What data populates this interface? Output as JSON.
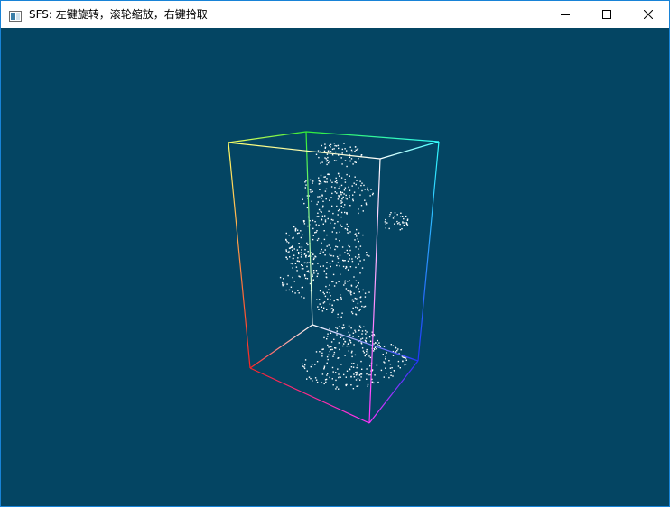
{
  "window": {
    "title": "SFS: 左键旋转，滚轮缩放，右键拾取"
  },
  "icons": {
    "app": "app-window-icon",
    "minimize": "minimize-icon",
    "maximize": "maximize-icon",
    "close": "close-icon"
  },
  "colors": {
    "viewport_background": "#044563",
    "point_color": "#ffffff",
    "window_border": "#1883d7"
  }
}
